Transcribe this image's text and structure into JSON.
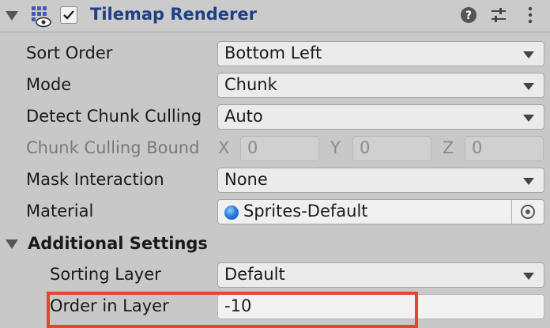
{
  "component": {
    "title": "Tilemap Renderer",
    "enabled": true,
    "icons": {
      "component": "tilemap-renderer-icon",
      "help": "help-icon",
      "presets": "presets-icon",
      "menu": "kebab-menu-icon"
    }
  },
  "properties": {
    "sort_order": {
      "label": "Sort Order",
      "value": "Bottom Left"
    },
    "mode": {
      "label": "Mode",
      "value": "Chunk"
    },
    "detect_chunk_culling": {
      "label": "Detect Chunk Culling",
      "value": "Auto"
    },
    "chunk_culling_bounds": {
      "label": "Chunk Culling Bound",
      "x_label": "X",
      "x": "0",
      "y_label": "Y",
      "y": "0",
      "z_label": "Z",
      "z": "0"
    },
    "mask_interaction": {
      "label": "Mask Interaction",
      "value": "None"
    },
    "material": {
      "label": "Material",
      "value": "Sprites-Default"
    }
  },
  "additional_settings": {
    "label": "Additional Settings",
    "sorting_layer": {
      "label": "Sorting Layer",
      "value": "Default"
    },
    "order_in_layer": {
      "label": "Order in Layer",
      "value": "-10"
    }
  },
  "colors": {
    "title": "#1f3f86",
    "highlight": "#e4462d"
  }
}
